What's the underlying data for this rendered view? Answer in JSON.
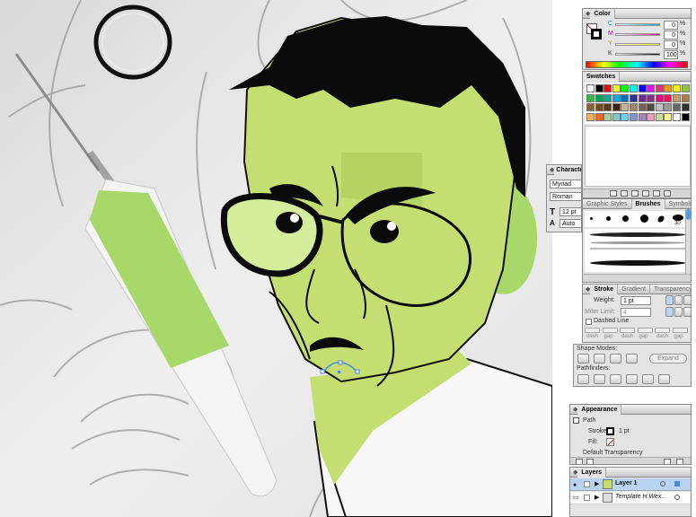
{
  "color_panel": {
    "tab": "Color",
    "channels": [
      {
        "letter": "C",
        "value": "0",
        "unit": "%"
      },
      {
        "letter": "M",
        "value": "0",
        "unit": "%"
      },
      {
        "letter": "Y",
        "value": "0",
        "unit": "%"
      },
      {
        "letter": "K",
        "value": "100",
        "unit": "%"
      }
    ]
  },
  "swatches_panel": {
    "tab": "Swatches"
  },
  "character_panel": {
    "tab": "Character",
    "font_family": "Myriad",
    "font_style": "Roman",
    "font_size": "12 pt",
    "leading": "Auto"
  },
  "brushes_panel": {
    "tabs": [
      "Graphic Styles",
      "Brushes",
      "Symbols"
    ],
    "brush_size": "30"
  },
  "stroke_panel": {
    "tabs": [
      "Stroke",
      "Gradient",
      "Transparency"
    ],
    "weight_label": "Weight:",
    "weight_value": "1 pt",
    "miter_label": "Miter Limit:",
    "miter_value": "4",
    "dashed_label": "Dashed Line",
    "dash_labels": [
      "dash",
      "gap",
      "dash",
      "gap",
      "dash",
      "gap"
    ]
  },
  "pathfinder_panel": {
    "shape_modes_label": "Shape Modes:",
    "expand_label": "Expand",
    "pathfinders_label": "Pathfinders:"
  },
  "appearance_panel": {
    "tab": "Appearance",
    "object": "Path",
    "stroke_label": "Stroke:",
    "stroke_value": "1 pt",
    "fill_label": "Fill:",
    "transparency": "Default Transparency"
  },
  "layers_panel": {
    "tab": "Layers",
    "layers": [
      {
        "name": "Layer 1",
        "selected": true
      },
      {
        "name": "Template H.Wex...",
        "selected": false
      }
    ]
  },
  "colors": {
    "face": "#c5de72",
    "face_shadow": "#b3d061",
    "accent_green": "#a9d86a",
    "hair": "#0a0a0a",
    "selection_blue": "#4a8ad8"
  }
}
